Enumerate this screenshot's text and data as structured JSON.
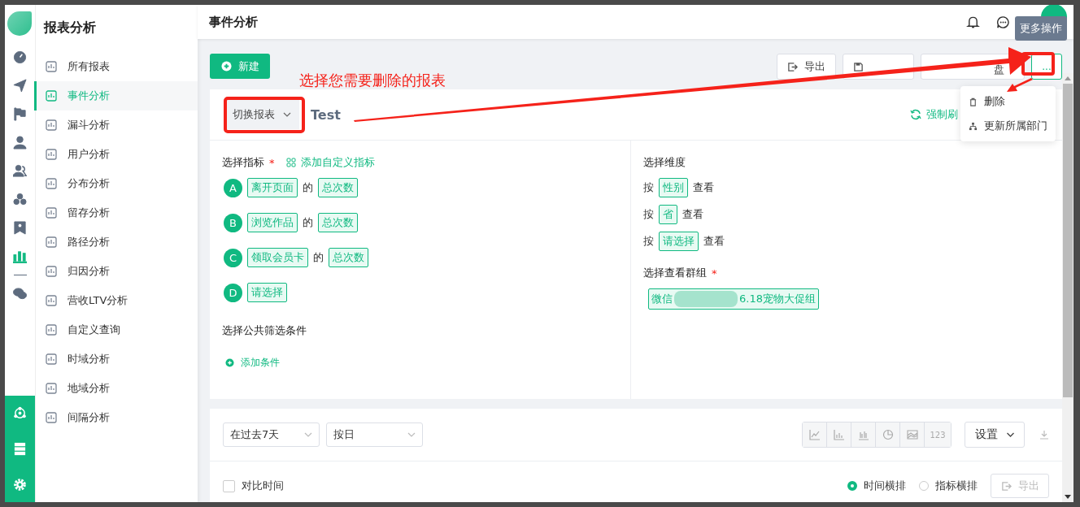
{
  "rail": {
    "items": [
      {
        "selected": false
      },
      {
        "selected": false
      },
      {
        "selected": false
      },
      {
        "selected": false
      },
      {
        "selected": false
      },
      {
        "selected": false
      },
      {
        "selected": false
      },
      {
        "selected": true
      },
      {
        "selected": false
      }
    ]
  },
  "sidebar": {
    "title": "报表分析",
    "items": [
      {
        "label": "所有报表",
        "selected": false
      },
      {
        "label": "事件分析",
        "selected": true
      },
      {
        "label": "漏斗分析",
        "selected": false
      },
      {
        "label": "用户分析",
        "selected": false
      },
      {
        "label": "分布分析",
        "selected": false
      },
      {
        "label": "留存分析",
        "selected": false
      },
      {
        "label": "路径分析",
        "selected": false
      },
      {
        "label": "归因分析",
        "selected": false
      },
      {
        "label": "营收LTV分析",
        "selected": false
      },
      {
        "label": "自定义查询",
        "selected": false
      },
      {
        "label": "时域分析",
        "selected": false
      },
      {
        "label": "地域分析",
        "selected": false
      },
      {
        "label": "间隔分析",
        "selected": false
      }
    ]
  },
  "header": {
    "title": "事件分析",
    "tooltip": "更多操作"
  },
  "toolbar": {
    "new_button": "新建",
    "export_button": "导出",
    "partial_button": "盘",
    "more_button": "..."
  },
  "menu": {
    "items": [
      "删除",
      "更新所属部门"
    ]
  },
  "annotation": {
    "text": "选择您需要删除的报表"
  },
  "report": {
    "switch_label": "切换报表",
    "name": "Test",
    "refresh": "强制刷"
  },
  "metrics": {
    "title": "选择指标",
    "required": "*",
    "add": "添加自定义指标",
    "rows": [
      {
        "letter": "A",
        "event": "离开页面",
        "joiner": "的",
        "measure": "总次数"
      },
      {
        "letter": "B",
        "event": "浏览作品",
        "joiner": "的",
        "measure": "总次数"
      },
      {
        "letter": "C",
        "event": "领取会员卡",
        "joiner": "的",
        "measure": "总次数"
      },
      {
        "letter": "D",
        "event": "请选择"
      }
    ]
  },
  "filters": {
    "title": "选择公共筛选条件",
    "add": "添加条件"
  },
  "dimensions": {
    "title": "选择维度",
    "rows": [
      {
        "prefix": "按",
        "value": "性别",
        "suffix": "查看"
      },
      {
        "prefix": "按",
        "value": "省",
        "suffix": "查看"
      },
      {
        "prefix": "按",
        "value": "请选择",
        "suffix": "查看"
      }
    ]
  },
  "group": {
    "title": "选择查看群组",
    "required": "*",
    "tag_start": "微信",
    "tag_end": "6.18宠物大促组"
  },
  "controls": {
    "range": "在过去7天",
    "unit": "按日",
    "numeric_button": "123",
    "settings": "设置"
  },
  "compare": {
    "label": "对比时间",
    "checked": false
  },
  "layout_options": [
    {
      "label": "时间横排",
      "selected": true
    },
    {
      "label": "指标横排",
      "selected": false
    }
  ],
  "bottom_export": "导出"
}
